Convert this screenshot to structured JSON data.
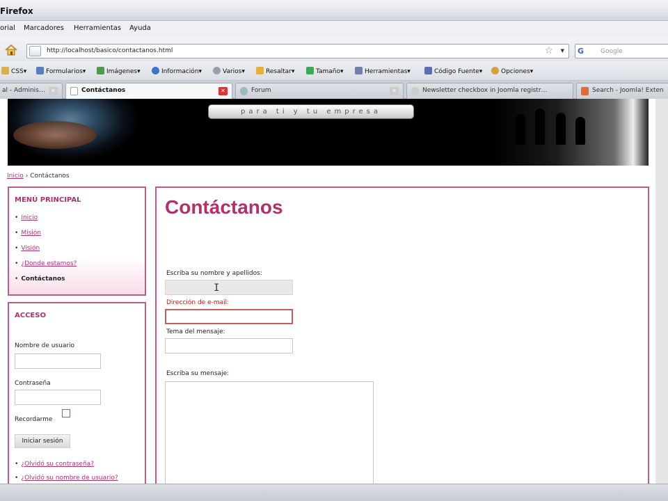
{
  "window": {
    "title": "Firefox"
  },
  "menubar": [
    "orial",
    "Marcadores",
    "Herramientas",
    "Ayuda"
  ],
  "navbar": {
    "url": "http://localhost/basico/contactanos.html",
    "search_placeholder": "Google",
    "search_logo": "G"
  },
  "toolbar": [
    {
      "label": "CSS▾",
      "icon": "folder-icon",
      "color": "#d6b04a"
    },
    {
      "label": "Formularios▾",
      "icon": "form-icon",
      "color": "#5a7fb8"
    },
    {
      "label": "Imágenes▾",
      "icon": "image-icon",
      "color": "#4f9a4f"
    },
    {
      "label": "Información▾",
      "icon": "info-icon",
      "color": "#3d74c9"
    },
    {
      "label": "Varios▾",
      "icon": "misc-icon",
      "color": "#9aa0a8"
    },
    {
      "label": "Resaltar▾",
      "icon": "pen-icon",
      "color": "#e0b23a"
    },
    {
      "label": "Tamaño▾",
      "icon": "resize-icon",
      "color": "#3fa65a"
    },
    {
      "label": "Herramientas▾",
      "icon": "wrench-icon",
      "color": "#6e7fa8"
    },
    {
      "label": "Código Fuente▾",
      "icon": "source-icon",
      "color": "#5a6fb0"
    },
    {
      "label": "Opciones▾",
      "icon": "options-icon",
      "color": "#d7a23a"
    }
  ],
  "tabs": [
    {
      "label": "al - Adminis…"
    },
    {
      "label": "Contáctanos",
      "active": true
    },
    {
      "label": "Forum"
    },
    {
      "label": "Newsletter checkbox in Joomla registr…"
    },
    {
      "label": "Search - Joomla! Exten"
    }
  ],
  "banner": {
    "slogan": "para ti y tu empresa"
  },
  "breadcrumb": {
    "home": "Inicio",
    "separator": "›",
    "current": "Contáctanos"
  },
  "menu": {
    "title": "MENÚ PRINCIPAL",
    "items": [
      {
        "label": "Inicio",
        "current": false
      },
      {
        "label": "Misión",
        "current": false
      },
      {
        "label": "Visión",
        "current": false
      },
      {
        "label": "¿Donde estamos?",
        "current": false
      },
      {
        "label": "Contáctanos",
        "current": true
      }
    ]
  },
  "login": {
    "title": "ACCESO",
    "username_label": "Nombre de usuario",
    "password_label": "Contraseña",
    "remember_label": "Recordarme",
    "remember_checked": false,
    "submit_label": "Iniciar sesión",
    "links": [
      "¿Olvidó su contraseña?",
      "¿Olvidó su nombre de usuario?"
    ]
  },
  "content": {
    "title": "Contáctanos",
    "form": {
      "name_label": "Escriba su nombre y apellidos:",
      "email_label": "Dirección de e-mail:",
      "subject_label": "Tema del mensaje:",
      "message_label": "Escriba su mensaje:",
      "name_value": "",
      "email_value": "",
      "subject_value": "",
      "message_value": ""
    }
  },
  "colors": {
    "accent": "#b0316c",
    "border": "#c25a92",
    "error": "#b32222"
  }
}
